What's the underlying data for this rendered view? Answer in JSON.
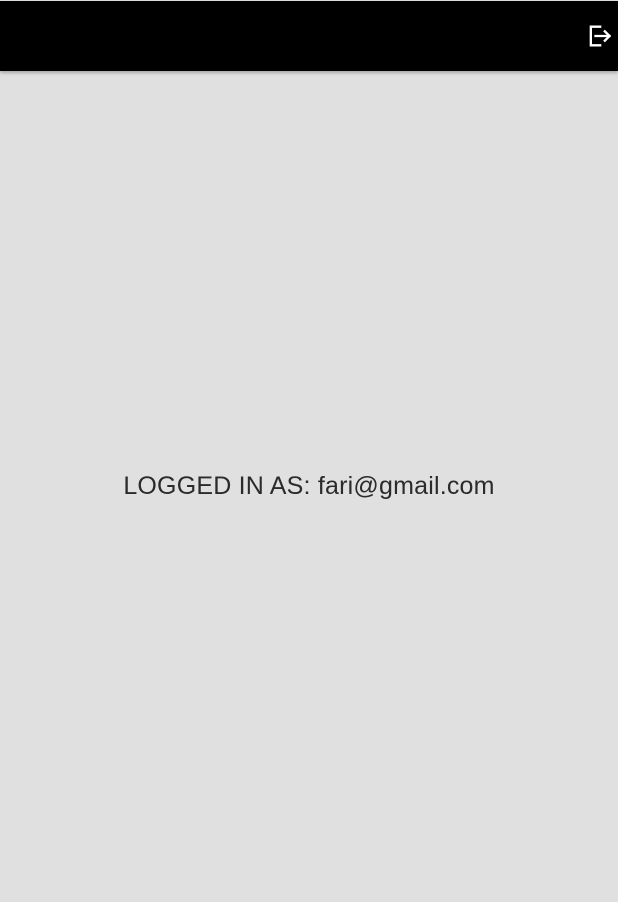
{
  "header": {
    "logout_icon": "logout-icon",
    "background_color": "#000000",
    "icon_color": "#ffffff"
  },
  "main": {
    "logged_in_label": "LOGGED IN AS:",
    "email": "fari@gmail.com",
    "text_color": "#2b2b2b",
    "background_color": "#e0e0e0"
  }
}
